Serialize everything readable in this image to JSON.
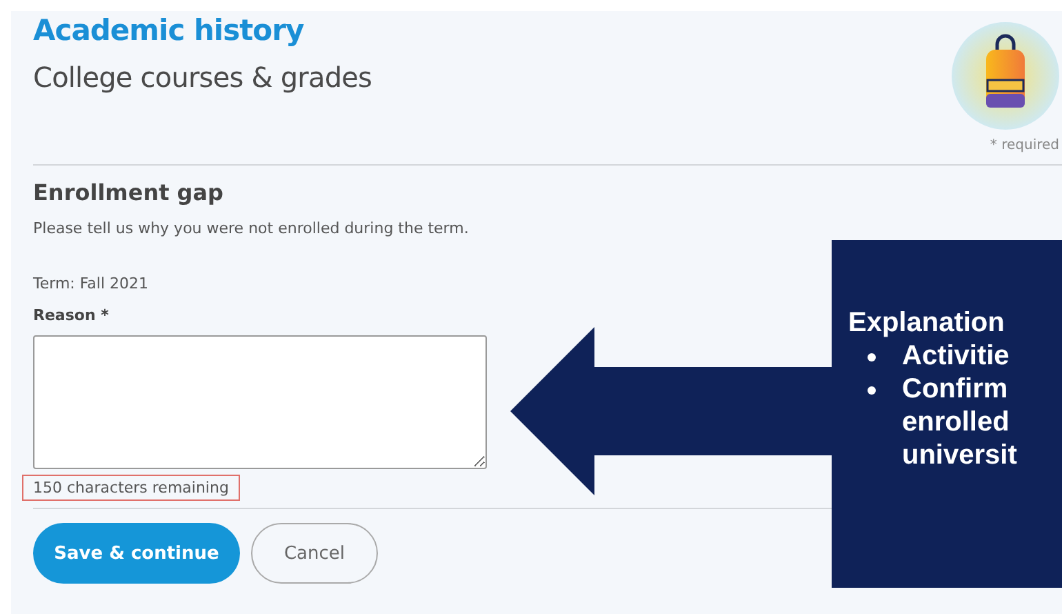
{
  "header": {
    "section": "Academic history",
    "title": "College courses & grades",
    "required_note": "* required"
  },
  "form": {
    "heading": "Enrollment gap",
    "instructions": "Please tell us why you were not enrolled during the term.",
    "term": "Term: Fall 2021",
    "reason_label": "Reason *",
    "counter": "150 characters remaining",
    "counter_highlighted": true
  },
  "buttons": [
    {
      "label": "Save & continue",
      "kind": "primary"
    },
    {
      "label": "Cancel",
      "kind": "secondary"
    }
  ],
  "callout": {
    "title": "Explanation",
    "items": [
      {
        "lines": [
          "Activitie"
        ]
      },
      {
        "lines": [
          "Confirm",
          "enrolled",
          "universit"
        ]
      }
    ]
  }
}
